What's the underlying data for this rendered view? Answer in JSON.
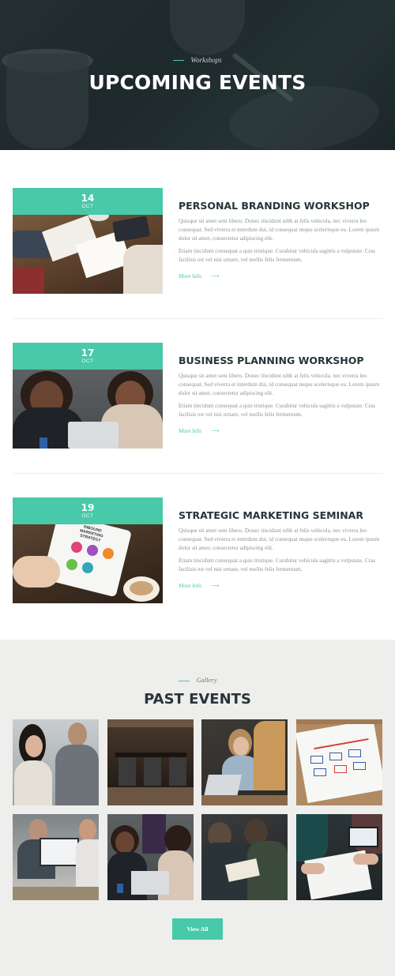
{
  "hero": {
    "eyebrow": "Workshops",
    "title": "UPCOMING EVENTS"
  },
  "events": [
    {
      "day": "14",
      "month": "OCT",
      "title": "PERSONAL BRANDING WORKSHOP",
      "paragraph1": "Quisque sit amet sem libero. Donec tincidunt nibh at felis vehicula, nec viverra leo consequat. Sed viverra et interdum dui, id consequat neque scelerisque eu. Lorem ipsum dolor sit amet, consectetur adipiscing elit.",
      "paragraph2": "Etiam tincidunt consequat a quis tristique. Curabitur vehicula sagittis a vulputate. Cras facilisis est vel nisi ornare, vel mollis felis fermentum.",
      "more_label": "More Info",
      "arrow": "⟶"
    },
    {
      "day": "17",
      "month": "OCT",
      "title": "BUSINESS PLANNING WORKSHOP",
      "paragraph1": "Quisque sit amet sem libero. Donec tincidunt nibh at felis vehicula, nec viverra leo consequat. Sed viverra et interdum dui, id consequat neque scelerisque eu. Lorem ipsum dolor sit amet, consectetur adipiscing elit.",
      "paragraph2": "Etiam tincidunt consequat a quis tristique. Curabitur vehicula sagittis a vulputate. Cras facilisis est vel nisi ornare, vel mollis felis fermentum.",
      "more_label": "More Info",
      "arrow": "⟶"
    },
    {
      "day": "19",
      "month": "OCT",
      "title": "STRATEGIC MARKETING SEMINAR",
      "paragraph1": "Quisque sit amet sem libero. Donec tincidunt nibh at felis vehicula, nec viverra leo consequat. Sed viverra et interdum dui, id consequat neque scelerisque eu. Lorem ipsum dolor sit amet, consectetur adipiscing elit.",
      "paragraph2": "Etiam tincidunt consequat a quis tristique. Curabitur vehicula sagittis a vulputate. Cras facilisis est vel nisi ornare, vel mollis felis fermentum.",
      "more_label": "More Info",
      "arrow": "⟶",
      "tablet_text": "INBOUND MARKETING STRATEGY"
    }
  ],
  "past": {
    "eyebrow": "Gallery",
    "title": "PAST EVENTS",
    "view_all_label": "View All"
  },
  "colors": {
    "accent": "#48c9a9",
    "heading": "#26353a",
    "body_text": "#8b9496",
    "past_bg": "#eeeeec"
  }
}
